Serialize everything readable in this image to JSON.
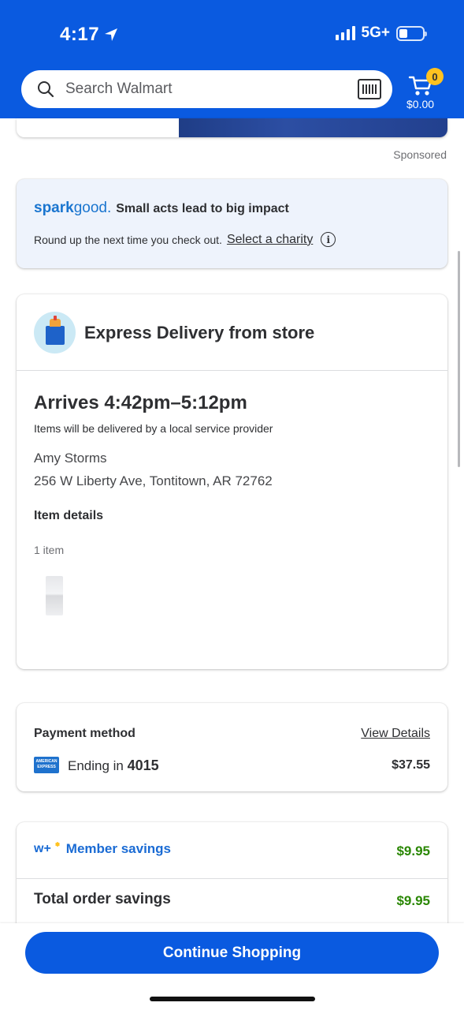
{
  "status_bar": {
    "time": "4:17",
    "network": "5G+"
  },
  "header": {
    "search": {
      "placeholder": "Search Walmart"
    },
    "cart": {
      "count": "0",
      "total": "$0.00"
    }
  },
  "ad": {
    "sponsored_label": "Sponsored"
  },
  "sparkgood": {
    "brand_part1": "spark",
    "brand_part2": "good.",
    "title": "Small acts lead to big impact",
    "body": "Round up the next time you check out.",
    "link": "Select a charity",
    "info_glyph": "i"
  },
  "delivery": {
    "title": "Express Delivery from store",
    "arrives": "Arrives 4:42pm–5:12pm",
    "provider_note": "Items will be delivered by a local service provider",
    "name": "Amy Storms",
    "address": "256 W Liberty Ave, Tontitown, AR 72762",
    "item_details_label": "Item details",
    "item_count": "1 item"
  },
  "payment": {
    "label": "Payment method",
    "view_details": "View Details",
    "card_prefix": "Ending in",
    "card_last4": "4015",
    "amount": "$37.55",
    "card_logo_text_1": "AMERICAN",
    "card_logo_text_2": "EXPRESS"
  },
  "savings": {
    "brand_mark": "w+",
    "member_label": "Member savings",
    "member_amount": "$9.95",
    "total_label": "Total order savings",
    "total_amount": "$9.95"
  },
  "footer": {
    "cta": "Continue Shopping"
  },
  "colors": {
    "brand_blue": "#0a5ae0",
    "spark_yellow": "#ffc220",
    "savings_green": "#2a8703"
  }
}
